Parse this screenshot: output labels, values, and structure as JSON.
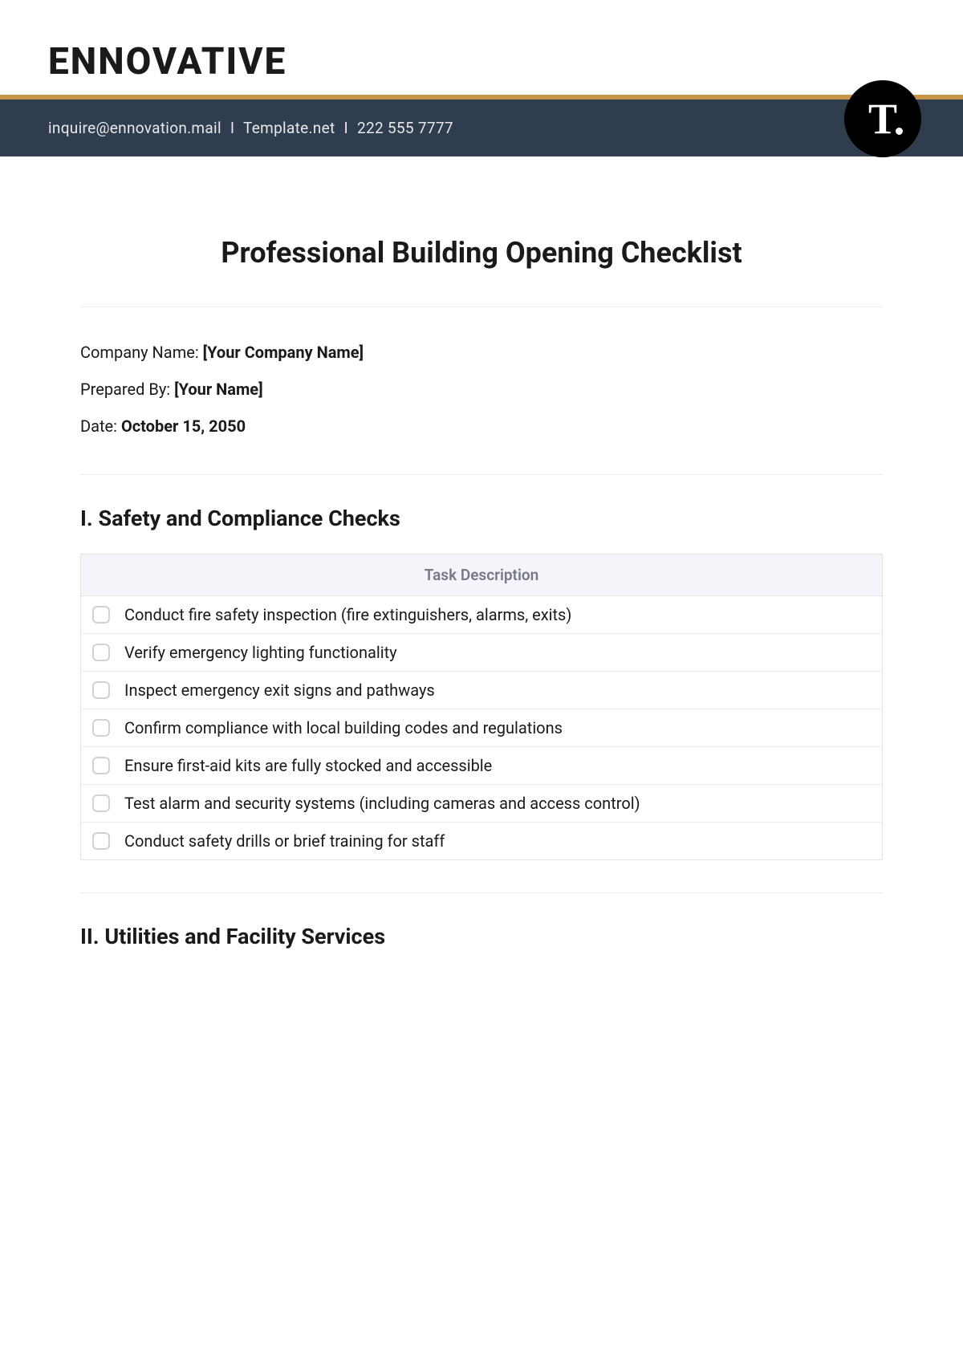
{
  "header": {
    "logo": "ENNOVATIVE",
    "contact_email": "inquire@ennovation.mail",
    "contact_site": "Template.net",
    "contact_phone": "222 555 7777",
    "badge_letter": "T"
  },
  "document": {
    "title": "Professional Building Opening Checklist",
    "meta": {
      "company_label": "Company Name: ",
      "company_value": "[Your Company Name]",
      "prepared_label": "Prepared By: ",
      "prepared_value": "[Your Name]",
      "date_label": "Date: ",
      "date_value": "October 15, 2050"
    }
  },
  "sections": {
    "s1": {
      "heading": "I. Safety and Compliance Checks",
      "table_header": "Task Description",
      "tasks": [
        "Conduct fire safety inspection (fire extinguishers, alarms, exits)",
        "Verify emergency lighting functionality",
        "Inspect emergency exit signs and pathways",
        "Confirm compliance with local building codes and regulations",
        "Ensure first-aid kits are fully stocked and accessible",
        "Test alarm and security systems (including cameras and access control)",
        "Conduct safety drills or brief training for staff"
      ]
    },
    "s2": {
      "heading": "II. Utilities and Facility Services"
    }
  }
}
